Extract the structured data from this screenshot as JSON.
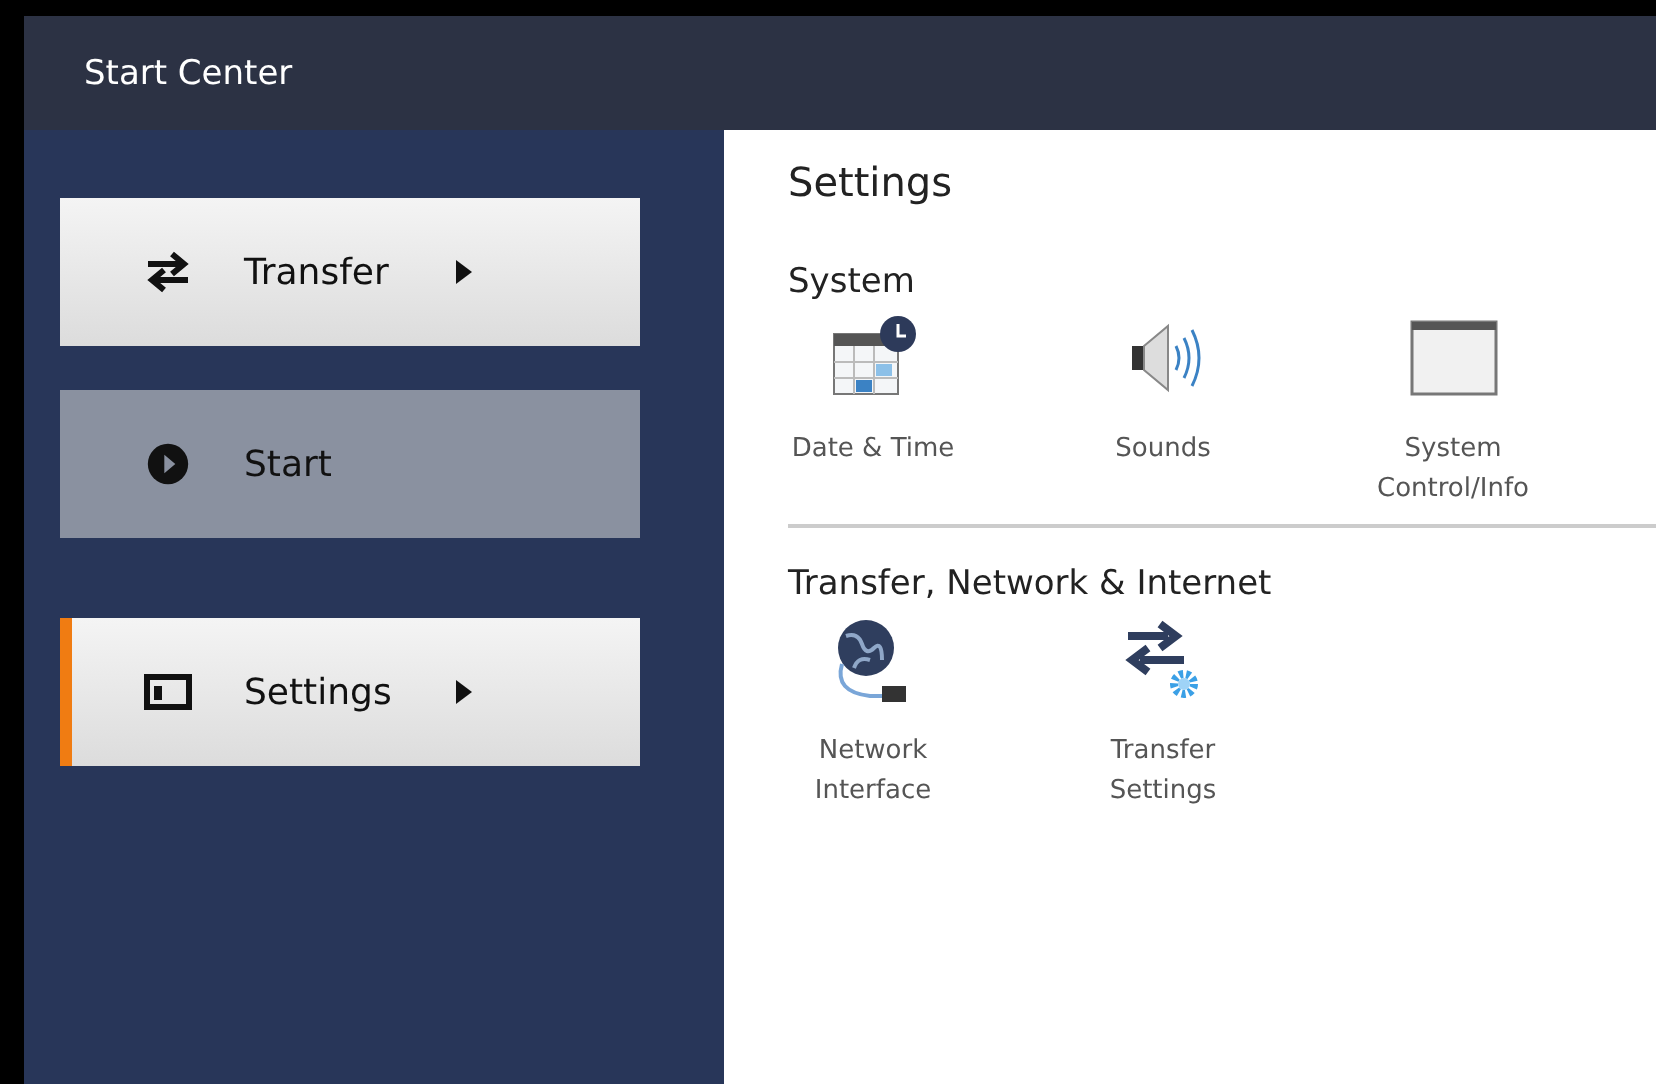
{
  "window": {
    "title": "Start Center"
  },
  "nav": [
    {
      "label": "Transfer",
      "selected": false,
      "disabled": false,
      "submenu": true
    },
    {
      "label": "Start",
      "selected": false,
      "disabled": true,
      "submenu": false
    },
    {
      "label": "Settings",
      "selected": true,
      "disabled": false,
      "submenu": true
    }
  ],
  "panel": {
    "title": "Settings",
    "sections": [
      {
        "title": "System",
        "items": [
          "Date & Time",
          "Sounds",
          "System Control/Info"
        ]
      },
      {
        "title": "Transfer, Network & Internet",
        "items": [
          "Network Interface",
          "Transfer Settings"
        ]
      }
    ]
  }
}
